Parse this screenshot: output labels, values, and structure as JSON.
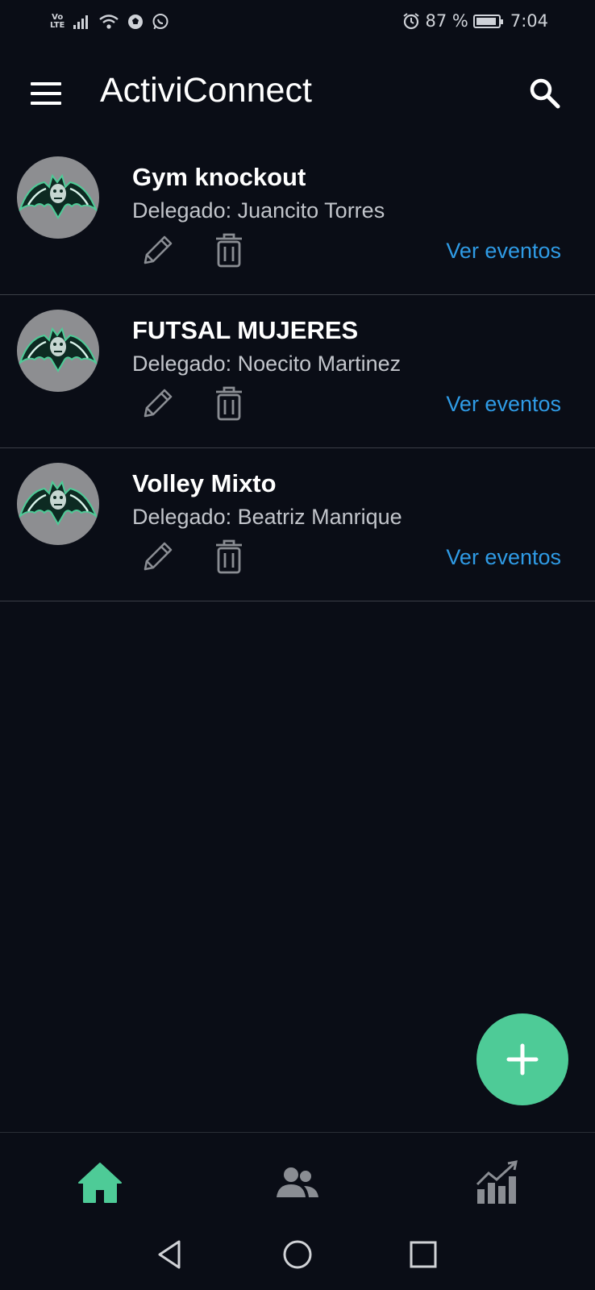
{
  "status_bar": {
    "network_label": "Vo LTE",
    "alarm_icon": "alarm-clock-icon",
    "battery_percent": "87 %",
    "battery_level": 0.87,
    "time": "7:04"
  },
  "app_bar": {
    "title": "ActiviConnect",
    "menu_icon": "hamburger-menu-icon",
    "search_icon": "search-icon"
  },
  "groups": [
    {
      "name": "Gym knockout",
      "delegate": "Delegado: Juancito Torres",
      "events_label": "Ver eventos"
    },
    {
      "name": "FUTSAL MUJERES",
      "delegate": "Delegado: Noecito Martinez",
      "events_label": "Ver eventos"
    },
    {
      "name": "Volley Mixto",
      "delegate": "Delegado: Beatriz Manrique",
      "events_label": "Ver eventos"
    }
  ],
  "fab": {
    "icon": "plus-icon"
  },
  "bottom_nav": {
    "items": [
      {
        "icon": "home-icon",
        "active": true
      },
      {
        "icon": "users-icon",
        "active": false
      },
      {
        "icon": "chart-icon",
        "active": false
      }
    ]
  },
  "colors": {
    "background": "#0a0d16",
    "accent": "#4ecb97",
    "link": "#2f9be5",
    "inactive_icon": "#8a8d93"
  }
}
